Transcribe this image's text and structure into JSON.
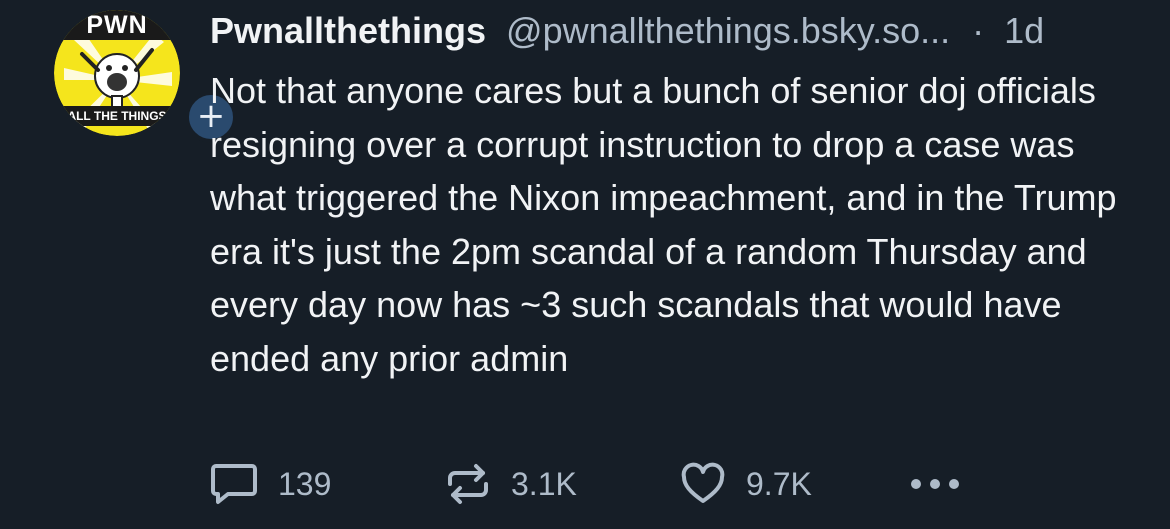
{
  "post": {
    "author": {
      "display_name": "Pwnallthethings",
      "handle": "@pwnallthethings.bsky.so...",
      "avatar_text_top": "PWN",
      "avatar_text_bottom": "ALL THE THINGS",
      "follow_icon": "plus-icon",
      "follow_label": "+"
    },
    "time_separator": "·",
    "timestamp": "1d",
    "text": "Not that anyone cares but a bunch of senior doj officials resigning over a corrupt instruction to drop a case was what triggered the Nixon impeachment, and in the Trump era it's just the 2pm scandal of a random Thursday and every day now has ~3 such scandals that would have ended any prior admin",
    "actions": {
      "reply": {
        "icon": "speech-bubble-icon",
        "count": "139"
      },
      "repost": {
        "icon": "repost-arrows-icon",
        "count": "3.1K"
      },
      "like": {
        "icon": "heart-icon",
        "count": "9.7K"
      },
      "more": {
        "icon": "ellipsis-icon"
      }
    }
  },
  "colors": {
    "background": "#161e27",
    "text": "#f1f3f5",
    "muted": "#aebbc9",
    "follow_button": "#2a4a6e",
    "avatar_yellow": "#f5e51c"
  }
}
